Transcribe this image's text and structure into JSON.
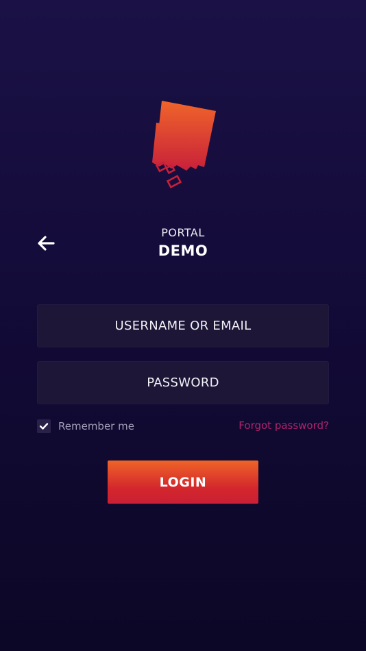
{
  "app": {
    "logo_icon": "puzzle-tag-logo",
    "brand_colors": {
      "gradient_top": "#ef6428",
      "gradient_bottom": "#c91f35",
      "link": "#b0246e",
      "background_top": "#1b1146",
      "background_bottom": "#0c0726"
    }
  },
  "header": {
    "back_icon": "arrow-left-icon",
    "portal_label": "PORTAL",
    "portal_name": "DEMO"
  },
  "form": {
    "username": {
      "placeholder": "USERNAME OR EMAIL",
      "value": ""
    },
    "password": {
      "placeholder": "PASSWORD",
      "value": ""
    },
    "remember_me": {
      "label": "Remember me",
      "checked": true
    },
    "forgot_password_label": "Forgot password?",
    "login_label": "LOGIN"
  }
}
